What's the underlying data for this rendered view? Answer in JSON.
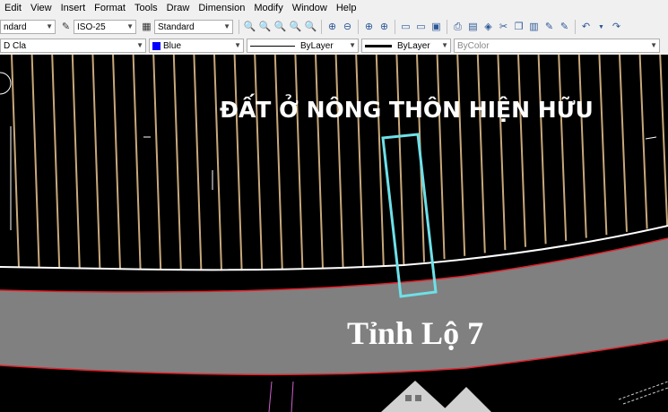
{
  "menu": {
    "items": [
      "Edit",
      "View",
      "Insert",
      "Format",
      "Tools",
      "Draw",
      "Dimension",
      "Modify",
      "Window",
      "Help"
    ]
  },
  "toolbar1": {
    "text_style": "ndard",
    "dim_style": "ISO-25",
    "table_style": "Standard"
  },
  "toolbar2": {
    "layer": "D Cla",
    "color": "Blue",
    "linetype": "ByLayer",
    "lineweight": "ByLayer",
    "plotstyle": "ByColor"
  },
  "drawing": {
    "area_label": "ĐẤT Ở NÔNG THÔN HIỆN HỮU",
    "road_label": "Tỉnh Lộ 7",
    "colors": {
      "background": "#000000",
      "parcel_lines": "#c8a87a",
      "road_fill": "#808080",
      "road_edge": "#e0202a",
      "highlight_parcel": "#6ee0e8",
      "boundary": "#ffffff"
    }
  }
}
